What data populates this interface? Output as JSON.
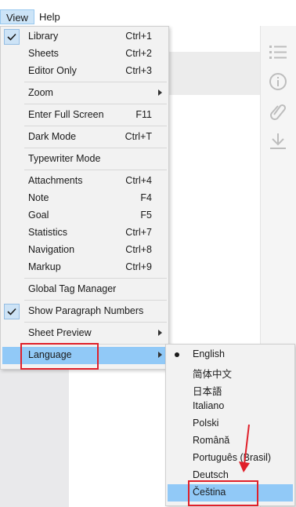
{
  "menubar": {
    "view_label": "View",
    "help_label": "Help"
  },
  "view_menu": {
    "library": {
      "label": "Library",
      "shortcut": "Ctrl+1"
    },
    "sheets": {
      "label": "Sheets",
      "shortcut": "Ctrl+2"
    },
    "editor_only": {
      "label": "Editor Only",
      "shortcut": "Ctrl+3"
    },
    "zoom": {
      "label": "Zoom"
    },
    "full_screen": {
      "label": "Enter Full Screen",
      "shortcut": "F11"
    },
    "dark_mode": {
      "label": "Dark Mode",
      "shortcut": "Ctrl+T"
    },
    "typewriter": {
      "label": "Typewriter Mode"
    },
    "attachments": {
      "label": "Attachments",
      "shortcut": "Ctrl+4"
    },
    "note": {
      "label": "Note",
      "shortcut": "F4"
    },
    "goal": {
      "label": "Goal",
      "shortcut": "F5"
    },
    "statistics": {
      "label": "Statistics",
      "shortcut": "Ctrl+7"
    },
    "navigation": {
      "label": "Navigation",
      "shortcut": "Ctrl+8"
    },
    "markup": {
      "label": "Markup",
      "shortcut": "Ctrl+9"
    },
    "tag_manager": {
      "label": "Global Tag Manager"
    },
    "paragraph_numbers": {
      "label": "Show Paragraph Numbers"
    },
    "sheet_preview": {
      "label": "Sheet Preview"
    },
    "language": {
      "label": "Language"
    }
  },
  "language_menu": {
    "english": "English",
    "chinese": "简体中文",
    "japanese": "日本語",
    "italian": "Italiano",
    "polish": "Polski",
    "romanian": "Română",
    "portuguese": "Português (Brasil)",
    "german": "Deutsch",
    "czech": "Čeština"
  },
  "icons": {
    "right_bar": [
      "list-icon",
      "info-icon",
      "paperclip-icon",
      "download-icon"
    ],
    "checked": "checkmark-icon",
    "submenu": "submenu-arrow-icon",
    "selected_language": "radio-dot-icon"
  },
  "colors": {
    "highlight": "#91c9f7",
    "check_box": "#cde3f6",
    "annotation": "#e0202a"
  }
}
